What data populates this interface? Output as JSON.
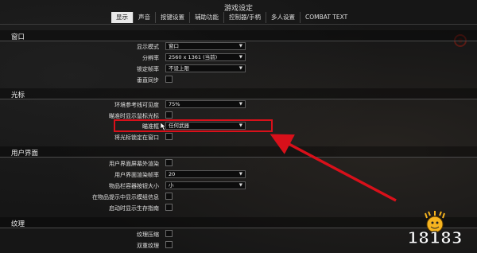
{
  "window": {
    "title": "游戏设定"
  },
  "tabs": [
    {
      "label": "显示",
      "active": true
    },
    {
      "label": "声音",
      "active": false
    },
    {
      "label": "按键设置",
      "active": false
    },
    {
      "label": "辅助功能",
      "active": false
    },
    {
      "label": "控制器/手柄",
      "active": false
    },
    {
      "label": "多人设置",
      "active": false
    },
    {
      "label": "COMBAT TEXT",
      "active": false
    }
  ],
  "sections": {
    "window": "窗口",
    "cursor": "光标",
    "ui": "用户界面",
    "texture": "纹理"
  },
  "window_settings": {
    "display_mode": {
      "label": "显示模式",
      "value": "窗口"
    },
    "resolution": {
      "label": "分辨率",
      "value": "2560 x 1361 (当前)"
    },
    "refresh_lock": {
      "label": "锁定帧率",
      "value": "不设上限"
    },
    "vsync": {
      "label": "垂直同步"
    }
  },
  "cursor_settings": {
    "ring_visibility": {
      "label": "环境参考线可见度",
      "value": "75%"
    },
    "aim_show_cursor": {
      "label": "瞄准时显示鼠标光标"
    },
    "aim_box": {
      "label": "瞄准框",
      "value": "任何武器"
    },
    "lock_cursor": {
      "label": "将光标锁定在窗口"
    }
  },
  "ui_settings": {
    "offscreen_render": {
      "label": "用户界面屏幕外渲染"
    },
    "ui_framerate": {
      "label": "用户界面渲染帧率",
      "value": "20"
    },
    "bag_button_size": {
      "label": "物品栏容器按钮大小",
      "value": "小"
    },
    "tooltip_blur": {
      "label": "在物品提示中显示模组信息"
    },
    "startup_guide": {
      "label": "启动时显示生存指南"
    }
  },
  "texture_settings": {
    "compression": {
      "label": "纹理压缩"
    },
    "dual_texture": {
      "label": "双重纹理"
    }
  },
  "watermark": {
    "text": "18183"
  },
  "colors": {
    "highlight": "#d8101a",
    "active_tab_bg": "#e9e9e9"
  }
}
